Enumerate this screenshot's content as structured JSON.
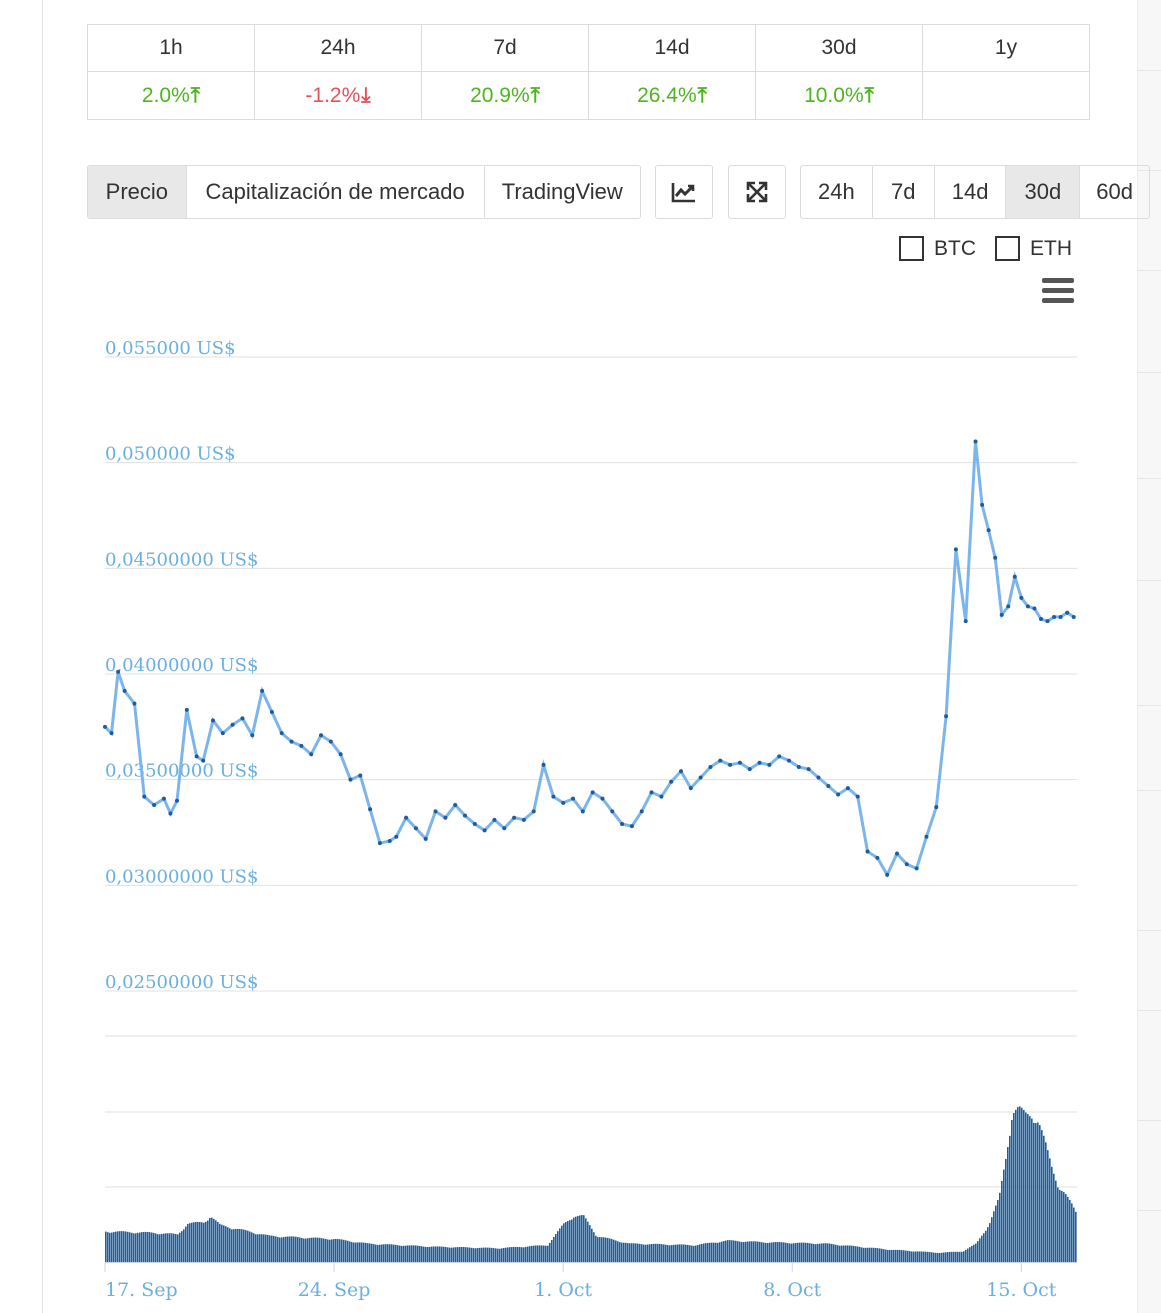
{
  "changes": {
    "periods": [
      "1h",
      "24h",
      "7d",
      "14d",
      "30d",
      "1y"
    ],
    "values": [
      {
        "text": "2.0%",
        "dir": "up"
      },
      {
        "text": "-1.2%",
        "dir": "down"
      },
      {
        "text": "20.9%",
        "dir": "up"
      },
      {
        "text": "26.4%",
        "dir": "up"
      },
      {
        "text": "10.0%",
        "dir": "up"
      },
      {
        "text": "",
        "dir": ""
      }
    ]
  },
  "toolbar": {
    "tabs": [
      "Precio",
      "Capitalización de mercado",
      "TradingView"
    ],
    "active_tab": "Precio",
    "ranges": [
      "24h",
      "7d",
      "14d",
      "30d",
      "60d"
    ],
    "active_range": "30d"
  },
  "compare": {
    "btc_label": "BTC",
    "eth_label": "ETH",
    "btc_checked": false,
    "eth_checked": false
  },
  "colors": {
    "line": "#7cb5ec",
    "marker": "#1f5c99",
    "volume": "#1f5c99",
    "axis_label": "#6ab0de",
    "up": "#4db51f",
    "down": "#e4525c"
  },
  "chart_data": {
    "type": "line",
    "y_tick_labels": [
      "0,055000 US$",
      "0,050000 US$",
      "0,04500000 US$",
      "0,04000000 US$",
      "0,03500000 US$",
      "0,03000000 US$",
      "0,02500000 US$"
    ],
    "y_ticks": [
      0.055,
      0.05,
      0.045,
      0.04,
      0.035,
      0.03,
      0.025
    ],
    "ylim": [
      0.025,
      0.055
    ],
    "x_tick_labels": [
      "17. Sep",
      "24. Sep",
      "1. Oct",
      "8. Oct",
      "15. Oct"
    ],
    "x_ticks": [
      0,
      7,
      14,
      21,
      28
    ],
    "x_units": "days since 17 Sep",
    "xlim": [
      0,
      29.7
    ],
    "series": [
      {
        "x": [
          0,
          0.2,
          0.4,
          0.6,
          0.9,
          1.2,
          1.5,
          1.8,
          2.0,
          2.2,
          2.5,
          2.8,
          3.0,
          3.3,
          3.6,
          3.9,
          4.2,
          4.5,
          4.8,
          5.1,
          5.4,
          5.7,
          6.0,
          6.3,
          6.6,
          6.9,
          7.2,
          7.5,
          7.8,
          8.1,
          8.4,
          8.7,
          8.9,
          9.2,
          9.5,
          9.8,
          10.1,
          10.4,
          10.7,
          11.0,
          11.3,
          11.6,
          11.9,
          12.2,
          12.5,
          12.8,
          13.1,
          13.4,
          13.7,
          14.0,
          14.3,
          14.6,
          14.9,
          15.2,
          15.5,
          15.8,
          16.1,
          16.4,
          16.7,
          17.0,
          17.3,
          17.6,
          17.9,
          18.2,
          18.5,
          18.8,
          19.1,
          19.4,
          19.7,
          20.0,
          20.3,
          20.6,
          20.9,
          21.2,
          21.5,
          21.8,
          22.1,
          22.4,
          22.7,
          23.0,
          23.3,
          23.6,
          23.9,
          24.2,
          24.5,
          24.8,
          25.1,
          25.4,
          25.7,
          26.0,
          26.3,
          26.6,
          26.8,
          27.0,
          27.2,
          27.4,
          27.6,
          27.8,
          28.0,
          28.2,
          28.4,
          28.6,
          28.8,
          29.0,
          29.2,
          29.4,
          29.6
        ],
        "y": [
          0.0375,
          0.0372,
          0.0401,
          0.0392,
          0.0386,
          0.0342,
          0.0338,
          0.0341,
          0.0334,
          0.034,
          0.0383,
          0.0361,
          0.0359,
          0.0378,
          0.0372,
          0.0376,
          0.0379,
          0.0371,
          0.0392,
          0.0382,
          0.0372,
          0.0368,
          0.0366,
          0.0362,
          0.0371,
          0.0368,
          0.0362,
          0.035,
          0.0352,
          0.0336,
          0.032,
          0.0321,
          0.0323,
          0.0332,
          0.0327,
          0.0322,
          0.0335,
          0.0332,
          0.0338,
          0.0333,
          0.0329,
          0.0326,
          0.0331,
          0.0327,
          0.0332,
          0.0331,
          0.0335,
          0.0357,
          0.0342,
          0.0339,
          0.0341,
          0.0335,
          0.0344,
          0.0341,
          0.0335,
          0.0329,
          0.0328,
          0.0335,
          0.0344,
          0.0342,
          0.0349,
          0.0354,
          0.0346,
          0.0351,
          0.0356,
          0.0359,
          0.0357,
          0.0358,
          0.0355,
          0.0358,
          0.0357,
          0.0361,
          0.0359,
          0.0356,
          0.0355,
          0.0351,
          0.0347,
          0.0343,
          0.0346,
          0.0342,
          0.0316,
          0.0313,
          0.0305,
          0.0315,
          0.031,
          0.0308,
          0.0323,
          0.0337,
          0.038,
          0.0459,
          0.0425,
          0.051,
          0.048,
          0.0468,
          0.0455,
          0.0428,
          0.0432,
          0.0446,
          0.0436,
          0.0432,
          0.0431,
          0.0426,
          0.0425,
          0.0427,
          0.0427,
          0.0429,
          0.0427
        ]
      }
    ],
    "volume": {
      "x": [
        0,
        1.5,
        2.2,
        2.5,
        3.0,
        3.2,
        3.5,
        5.0,
        7.0,
        8.0,
        10.0,
        12.0,
        13.5,
        14.0,
        14.3,
        14.6,
        15.0,
        16.0,
        18.0,
        19.0,
        20.0,
        22.0,
        24.0,
        25.5,
        26.2,
        26.6,
        27.0,
        27.3,
        27.5,
        27.7,
        27.9,
        28.1,
        28.3,
        28.5,
        28.7,
        28.9,
        29.1,
        29.3,
        29.5,
        29.7
      ],
      "heights": [
        0.2,
        0.19,
        0.18,
        0.25,
        0.26,
        0.3,
        0.24,
        0.17,
        0.15,
        0.12,
        0.1,
        0.09,
        0.11,
        0.25,
        0.3,
        0.3,
        0.17,
        0.12,
        0.11,
        0.14,
        0.13,
        0.12,
        0.08,
        0.06,
        0.07,
        0.12,
        0.25,
        0.42,
        0.68,
        0.98,
        1.0,
        0.96,
        0.96,
        0.92,
        0.78,
        0.62,
        0.5,
        0.45,
        0.38,
        0.3
      ]
    }
  }
}
